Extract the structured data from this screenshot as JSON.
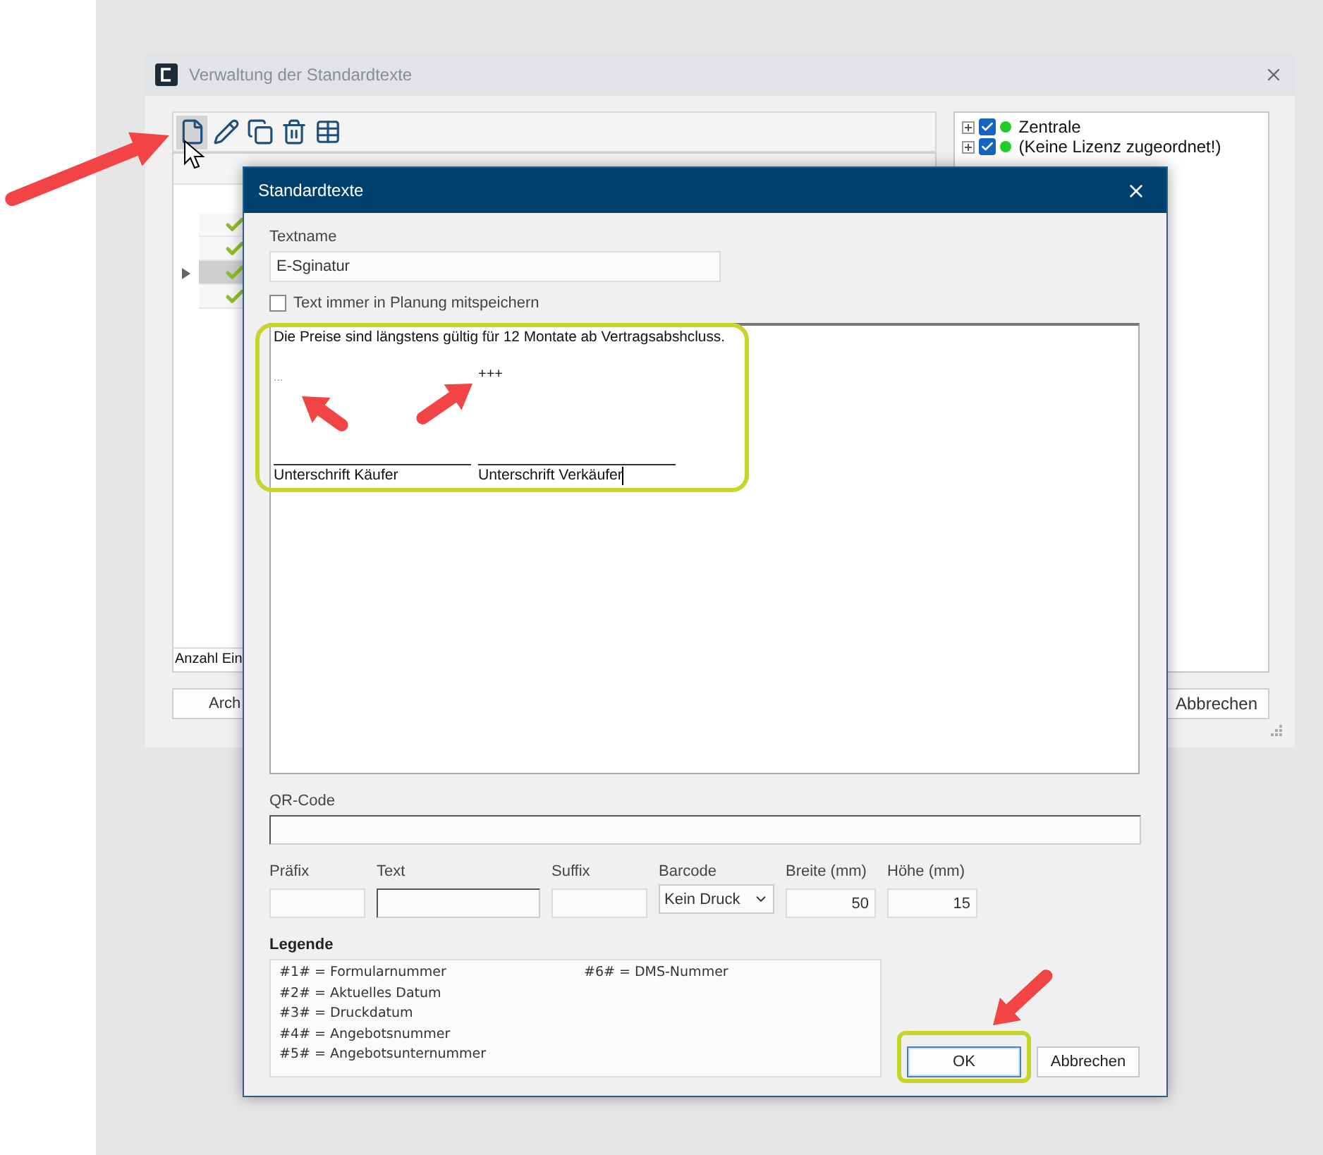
{
  "main_window": {
    "title": "Verwaltung der Standardtexte",
    "toolbar": [
      {
        "kind": "new",
        "selected": true
      },
      {
        "kind": "edit",
        "selected": false
      },
      {
        "kind": "copy",
        "selected": false
      },
      {
        "kind": "delete",
        "selected": false
      },
      {
        "kind": "table",
        "selected": false
      }
    ],
    "list": {
      "rows": [
        {
          "selected": false
        },
        {
          "selected": false
        },
        {
          "selected": true
        },
        {
          "selected": false
        }
      ],
      "footer": "Anzahl Ein"
    },
    "tree": [
      {
        "label": "Zentrale",
        "checked": true
      },
      {
        "label": "(Keine Lizenz zugeordnet!)",
        "checked": true
      }
    ],
    "buttons": [
      "Arch",
      "Abbrechen"
    ]
  },
  "dialog": {
    "title": "Standardtexte",
    "textname": {
      "label": "Textname",
      "value": "E-Sginatur"
    },
    "always_save": {
      "label": "Text immer in Planung mitspeichern",
      "checked": false
    },
    "editor": {
      "first_line": "Die Preise sind längstens gültig für 12 Montate ab Vertragsabshcluss.",
      "columns": [
        {
          "mark": "...",
          "signature": "Unterschrift Käufer"
        },
        {
          "mark": "+++",
          "signature": "Unterschrift Verkäufer"
        }
      ]
    },
    "qr_code": {
      "label": "QR-Code"
    },
    "fields": [
      {
        "kind": "input",
        "label": "Präfix",
        "focused": false
      },
      {
        "kind": "input",
        "label": "Text",
        "focused": true
      },
      {
        "kind": "input",
        "label": "Suffix",
        "focused": false
      },
      {
        "kind": "select",
        "label": "Barcode",
        "value": "Kein Druck"
      },
      {
        "kind": "number",
        "label": "Breite (mm)",
        "value": "50"
      },
      {
        "kind": "number",
        "label": "Höhe (mm)",
        "value": "15"
      }
    ],
    "legend": {
      "title": "Legende",
      "entries": [
        "#1# = Formularnummer",
        "#2# = Aktuelles Datum",
        "#3# = Druckdatum",
        "#4# = Angebotsnummer",
        "#5# = Angebotsunternummer",
        "#6# = DMS-Nummer"
      ]
    },
    "buttons": [
      {
        "label": "OK",
        "default": true
      },
      {
        "label": "Abbrechen",
        "default": false
      }
    ]
  }
}
